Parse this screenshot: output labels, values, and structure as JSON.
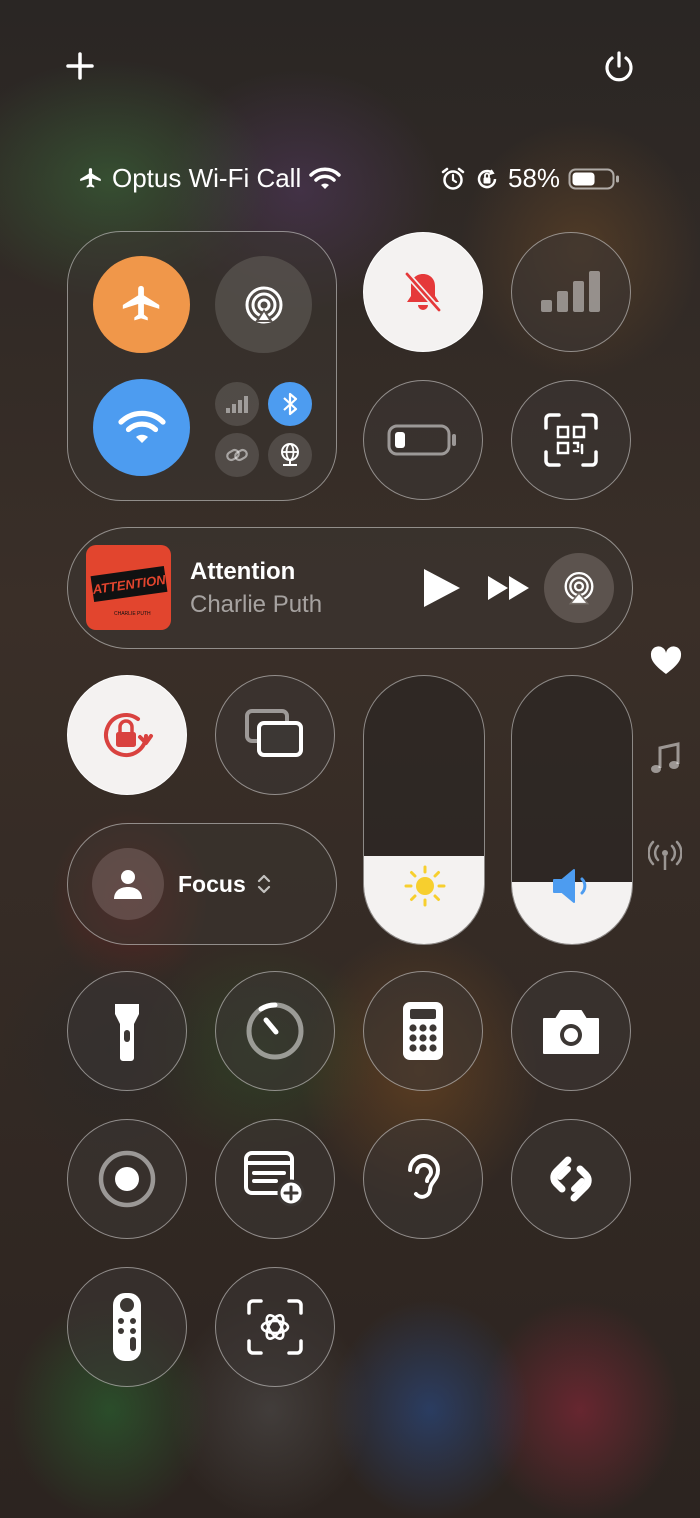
{
  "top": {
    "add_icon": "plus-icon",
    "power_icon": "power-icon"
  },
  "status_bar": {
    "carrier": "Optus Wi-Fi Call",
    "battery_percent": "58%",
    "battery_level": 0.58,
    "icons": [
      "airplane-icon",
      "wifi-icon",
      "alarm-icon",
      "orientation-lock-icon",
      "battery-icon"
    ]
  },
  "connectivity": {
    "airplane_mode": true,
    "wifi": true,
    "bluetooth": true,
    "cellular_data": false,
    "airdrop": false,
    "personal_hotspot": false,
    "vpn": false
  },
  "colors": {
    "airplane_accent": "#f0974a",
    "wifi_accent": "#4d9cf0",
    "bluetooth_accent": "#4d9cf0",
    "silent_red": "#e5393a",
    "orientation_lock_red": "#d9423f",
    "brightness_yellow": "#f7cf2e",
    "volume_blue": "#4d9cf0"
  },
  "now_playing": {
    "title": "Attention",
    "artist": "Charlie Puth",
    "artwork_text": "ATTENTION",
    "artwork_subtext": "CHARLIE PUTH"
  },
  "focus": {
    "label": "Focus",
    "chevron": "⌃⌄"
  },
  "sliders": {
    "brightness_level": 0.33,
    "volume_level": 0.23
  },
  "controls": [
    "silent-mode",
    "cellular-signal",
    "low-power-mode",
    "code-scanner",
    "orientation-lock",
    "screen-mirroring",
    "flashlight",
    "timer",
    "calculator",
    "camera",
    "screen-recording",
    "quick-note",
    "hearing",
    "shazam",
    "apple-tv-remote",
    "visual-intelligence"
  ],
  "side": {
    "icons": [
      "heart-icon",
      "music-note-icon",
      "antenna-icon"
    ]
  }
}
